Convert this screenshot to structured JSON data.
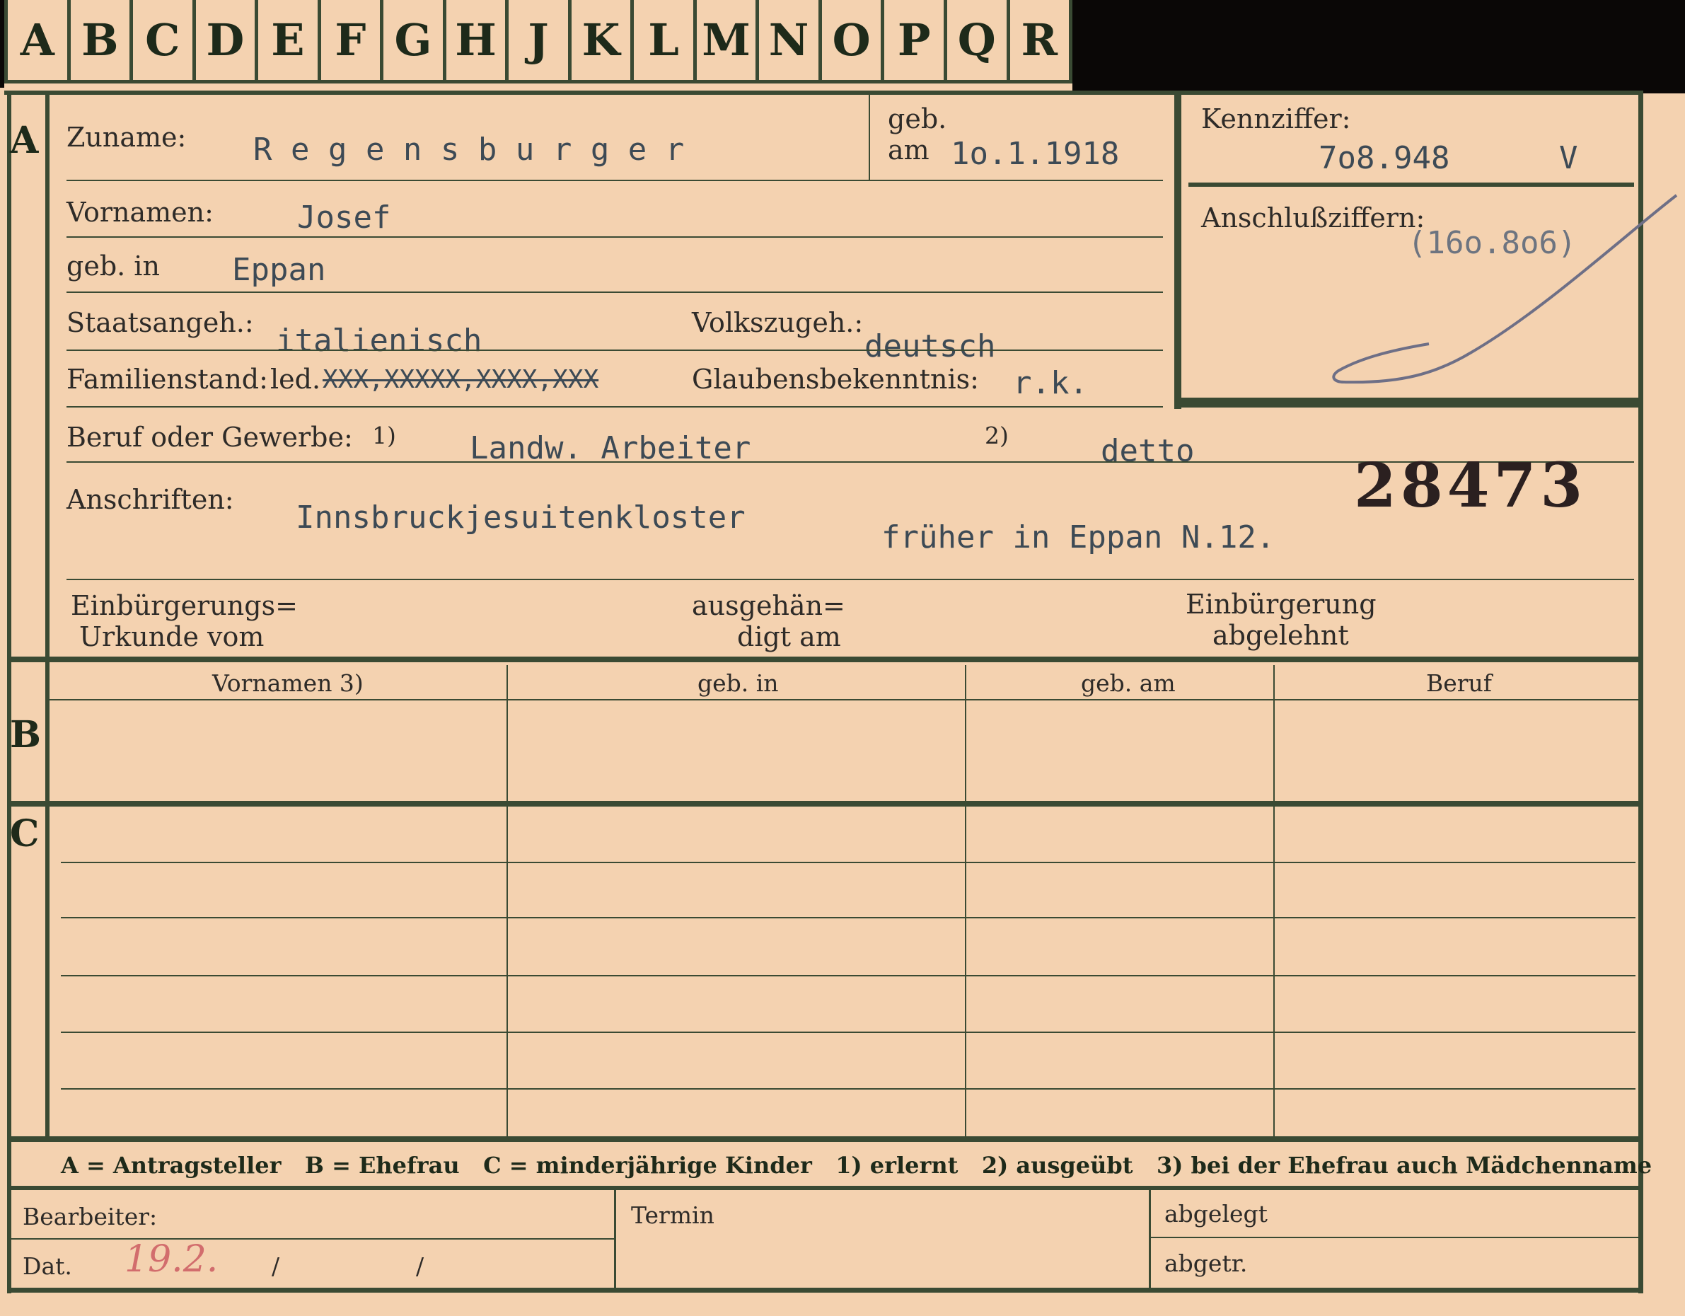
{
  "tabs": [
    "A",
    "B",
    "C",
    "D",
    "E",
    "F",
    "G",
    "H",
    "J",
    "K",
    "L",
    "M",
    "N",
    "O",
    "P",
    "Q",
    "R"
  ],
  "section_a": {
    "letter": "A",
    "surname_label": "Zuname:",
    "surname": "R e g e n s b u r g e r",
    "born_label_1": "geb.",
    "born_label_2": "am",
    "born_date": "1o.1.1918",
    "kennziffer_label": "Kennziffer:",
    "kennziffer": "7o8.948",
    "kennziffer_suffix": "V",
    "anschluss_label": "Anschlußziffern:",
    "anschluss": "(16o.8o6)",
    "firstname_label": "Vornamen:",
    "firstname": "Josef",
    "birthplace_label": "geb. in",
    "birthplace": "Eppan",
    "citizenship_label": "Staatsangeh.:",
    "citizenship": "italienisch",
    "ethnicity_label": "Volkszugeh.:",
    "ethnicity": "deutsch",
    "marital_label": "Familienstand:",
    "marital_prefix": "led.",
    "marital_struck": "XXX,XXXXX,XXXX,XXX",
    "religion_label": "Glaubensbekenntnis:",
    "religion": "r.k.",
    "occupation_label": "Beruf oder Gewerbe:",
    "occupation_note_1": "1)",
    "occupation_1": "Landw. Arbeiter",
    "occupation_note_2": "2)",
    "occupation_2": "detto",
    "stamp_number": "28473",
    "address_label": "Anschriften:",
    "address_1": "Innsbruckjesuitenkloster",
    "address_2": "früher in Eppan N.12.",
    "naturalization_label_1": "Einbürgerungs=",
    "naturalization_label_2": "Urkunde vom",
    "handed_label_1": "ausgehän=",
    "handed_label_2": "digt am",
    "rejected_label_1": "Einbürgerung",
    "rejected_label_2": "abgelehnt"
  },
  "section_b": {
    "letter": "B",
    "columns": [
      "Vornamen 3)",
      "geb. in",
      "geb. am",
      "Beruf"
    ]
  },
  "section_c": {
    "letter": "C"
  },
  "legend": "A = Antragsteller   B = Ehefrau   C = minderjährige Kinder   1) erlernt   2) ausgeübt   3) bei der Ehefrau auch Mädchenname",
  "footer": {
    "bearbeiter_label": "Bearbeiter:",
    "dat_label": "Dat.",
    "dat_value": "19.2.",
    "slash_1": "/",
    "slash_2": "/",
    "termin_label": "Termin",
    "abgelegt_label": "abgelegt",
    "abgetr_label": "abgetr."
  },
  "colors": {
    "paper": "#f4d2b0",
    "ink_green": "#3a4a33",
    "typewriter": "#3d4a55",
    "pencil_red": "#d26d6d",
    "background": "#0a0706"
  }
}
